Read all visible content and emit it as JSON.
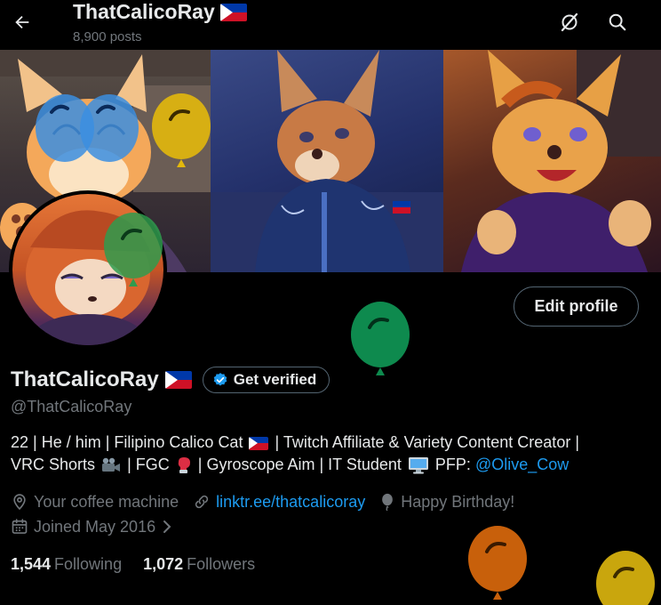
{
  "header": {
    "title": "ThatCalicoRay",
    "post_count": "8,900 posts"
  },
  "profile": {
    "display_name": "ThatCalicoRay",
    "verify_label": "Get verified",
    "handle": "@ThatCalicoRay",
    "edit_label": "Edit profile"
  },
  "bio": {
    "line1_a": "22 | He / him | Filipino Calico Cat",
    "line1_b": "| Twitch Affiliate & Variety Content Creator |",
    "line2_a": "VRC Shorts",
    "line2_b": "| FGC",
    "line2_c": "| Gyroscope Aim | IT Student",
    "line2_d": "PFP:",
    "mention": "@Olive_Cow"
  },
  "meta": {
    "location": "Your coffee machine",
    "website": "linktr.ee/thatcalicoray",
    "birthday": "Happy Birthday!",
    "joined": "Joined May 2016"
  },
  "stats": {
    "following_count": "1,544",
    "following_label": "Following",
    "followers_count": "1,072",
    "followers_label": "Followers"
  },
  "colors": {
    "background": "#000000",
    "text_primary": "#e7e9ea",
    "text_secondary": "#71767b",
    "link": "#1d9bf0",
    "border": "#536471",
    "verified_badge": "#1d9bf0"
  },
  "icons": {
    "back": "arrow-left-icon",
    "grok": "grok-icon",
    "search": "search-icon",
    "location": "location-pin-icon",
    "website": "link-icon",
    "birthday": "balloon-icon",
    "joined": "calendar-icon",
    "joined_more": "chevron-right-icon",
    "verified": "verified-badge-icon"
  }
}
